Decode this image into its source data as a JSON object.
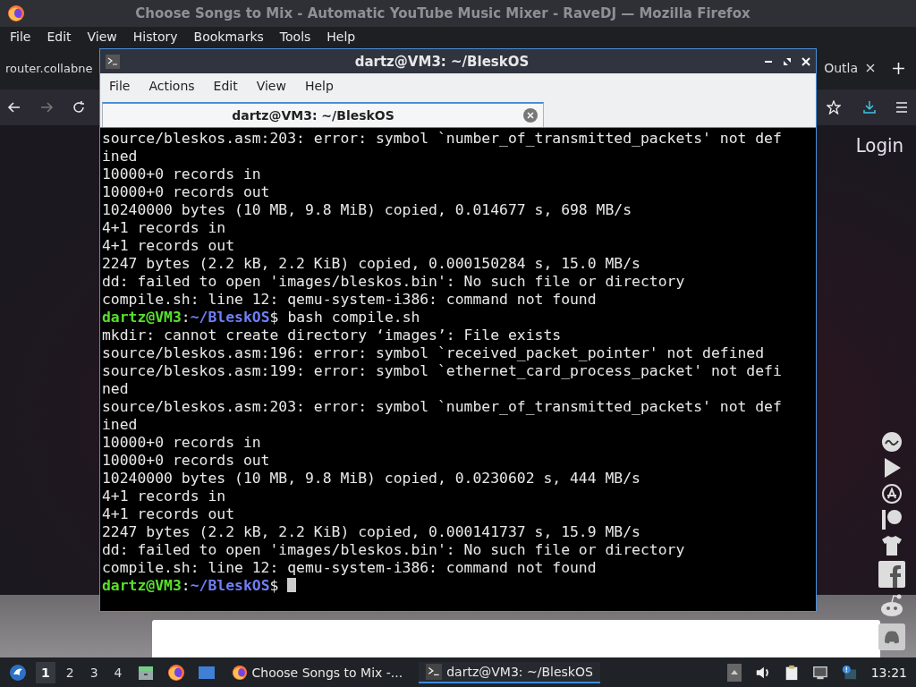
{
  "browser": {
    "title": "Choose Songs to Mix - Automatic YouTube Music Mixer - RaveDJ — Mozilla Firefox",
    "menu": [
      "File",
      "Edit",
      "View",
      "History",
      "Bookmarks",
      "Tools",
      "Help"
    ],
    "tabs": [
      {
        "label": "router.collabne",
        "selected": false
      },
      {
        "label": "Outla",
        "selected": false
      }
    ],
    "page": {
      "login": "Login"
    }
  },
  "terminal": {
    "title": "dartz@VM3: ~/BleskOS",
    "menu": [
      "File",
      "Actions",
      "Edit",
      "View",
      "Help"
    ],
    "tab": {
      "label": "dartz@VM3: ~/BleskOS",
      "selected": true
    },
    "lines": [
      {
        "kind": "output",
        "text": "source/bleskos.asm:203: error: symbol `number_of_transmitted_packets' not def"
      },
      {
        "kind": "output",
        "text": "ined"
      },
      {
        "kind": "output",
        "text": "10000+0 records in"
      },
      {
        "kind": "output",
        "text": "10000+0 records out"
      },
      {
        "kind": "output",
        "text": "10240000 bytes (10 MB, 9.8 MiB) copied, 0.014677 s, 698 MB/s"
      },
      {
        "kind": "output",
        "text": "4+1 records in"
      },
      {
        "kind": "output",
        "text": "4+1 records out"
      },
      {
        "kind": "output",
        "text": "2247 bytes (2.2 kB, 2.2 KiB) copied, 0.000150284 s, 15.0 MB/s"
      },
      {
        "kind": "output",
        "text": "dd: failed to open 'images/bleskos.bin': No such file or directory"
      },
      {
        "kind": "output",
        "text": "compile.sh: line 12: qemu-system-i386: command not found"
      },
      {
        "kind": "prompt",
        "user": "dartz@VM3",
        "sep": ":",
        "path": "~/BleskOS",
        "sign": "$",
        "text": "bash compile.sh",
        "cursor": false
      },
      {
        "kind": "output",
        "text": "mkdir: cannot create directory ‘images’: File exists"
      },
      {
        "kind": "output",
        "text": "source/bleskos.asm:196: error: symbol `received_packet_pointer' not defined"
      },
      {
        "kind": "output",
        "text": "source/bleskos.asm:199: error: symbol `ethernet_card_process_packet' not defi"
      },
      {
        "kind": "output",
        "text": "ned"
      },
      {
        "kind": "output",
        "text": "source/bleskos.asm:203: error: symbol `number_of_transmitted_packets' not def"
      },
      {
        "kind": "output",
        "text": "ined"
      },
      {
        "kind": "output",
        "text": "10000+0 records in"
      },
      {
        "kind": "output",
        "text": "10000+0 records out"
      },
      {
        "kind": "output",
        "text": "10240000 bytes (10 MB, 9.8 MiB) copied, 0.0230602 s, 444 MB/s"
      },
      {
        "kind": "output",
        "text": "4+1 records in"
      },
      {
        "kind": "output",
        "text": "4+1 records out"
      },
      {
        "kind": "output",
        "text": "2247 bytes (2.2 kB, 2.2 KiB) copied, 0.000141737 s, 15.9 MB/s"
      },
      {
        "kind": "output",
        "text": "dd: failed to open 'images/bleskos.bin': No such file or directory"
      },
      {
        "kind": "output",
        "text": "compile.sh: line 12: qemu-system-i386: command not found"
      },
      {
        "kind": "prompt",
        "user": "dartz@VM3",
        "sep": ":",
        "path": "~/BleskOS",
        "sign": "$",
        "cursor": true
      }
    ]
  },
  "taskbar": {
    "workspaces": [
      {
        "label": "1",
        "selected": true
      },
      {
        "label": "2",
        "selected": false
      },
      {
        "label": "3",
        "selected": false
      },
      {
        "label": "4",
        "selected": false
      }
    ],
    "tasks": [
      {
        "label": "Choose Songs to Mix -...",
        "kind": "firefox",
        "selected": false
      },
      {
        "label": "dartz@VM3: ~/BleskOS",
        "kind": "terminal",
        "selected": true
      }
    ],
    "clock": "13:21"
  }
}
